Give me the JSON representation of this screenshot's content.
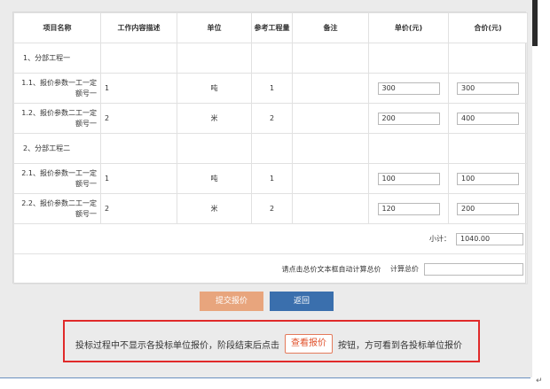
{
  "table": {
    "headers": [
      "项目名称",
      "工作内容描述",
      "单位",
      "参考工程量",
      "备注",
      "单价(元)",
      "合价(元)"
    ],
    "groups": [
      {
        "name": "1、分部工程一",
        "rows": [
          {
            "name": "1.1、报价参数一工一定额号一",
            "desc": "1",
            "unit": "吨",
            "qty": "1",
            "note": "",
            "price": "300",
            "total": "300"
          },
          {
            "name": "1.2、报价参数二工一定额号一",
            "desc": "2",
            "unit": "米",
            "qty": "2",
            "note": "",
            "price": "200",
            "total": "400"
          }
        ]
      },
      {
        "name": "2、分部工程二",
        "rows": [
          {
            "name": "2.1、报价参数一工一定额号一",
            "desc": "1",
            "unit": "吨",
            "qty": "1",
            "note": "",
            "price": "100",
            "total": "100"
          },
          {
            "name": "2.2、报价参数二工一定额号一",
            "desc": "2",
            "unit": "米",
            "qty": "2",
            "note": "",
            "price": "120",
            "total": "200"
          }
        ]
      }
    ],
    "subtotal_label": "小计：",
    "subtotal_value": "1040.00",
    "total_prompt": "请点击总价文本框自动计算总价",
    "total_label": "计算总价",
    "total_value": ""
  },
  "buttons": {
    "submit": "提交报价",
    "back": "返回"
  },
  "notice": {
    "text_before": "投标过程中不显示各投标单位报价，阶段结束后点击",
    "view_button": "查看报价",
    "text_after": "按钮，方可看到各投标单位报价"
  },
  "colors": {
    "submit_bg": "#e8a57d",
    "back_bg": "#3a6fad",
    "notice_border": "#e02a2a",
    "view_button_text": "#e0502a"
  },
  "return_mark": "↵"
}
